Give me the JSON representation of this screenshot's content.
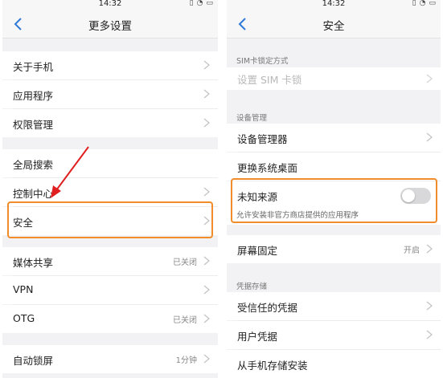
{
  "status_bar": {
    "time_left": "14:32",
    "time_right": "14:32",
    "icons": [
      "sim-icon",
      "wifi-icon",
      "battery-icon"
    ]
  },
  "left_screen": {
    "title": "更多设置",
    "items": [
      {
        "label": "关于手机"
      },
      {
        "label": "应用程序"
      },
      {
        "label": "权限管理"
      },
      {
        "label": "全局搜索"
      },
      {
        "label": "控制中心"
      },
      {
        "label": "安全"
      },
      {
        "label": "媒体共享",
        "value": "已关闭"
      },
      {
        "label": "VPN"
      },
      {
        "label": "OTG",
        "value": "已关闭"
      },
      {
        "label": "自动锁屏",
        "value": "1分钟"
      }
    ]
  },
  "right_screen": {
    "title": "安全",
    "sim_section_header": "SIM卡锁定方式",
    "sim_lock_item": "设置 SIM 卡锁",
    "device_section_header": "设备管理",
    "device_manager": "设备管理器",
    "change_launcher": "更换系统桌面",
    "unknown_sources": "未知来源",
    "unknown_sources_desc": "允许安装非官方商店提供的应用程序",
    "unknown_sources_enabled": false,
    "screen_pinning": "屏幕固定",
    "screen_pinning_value": "开启",
    "credential_section_header": "凭据存储",
    "trusted_credentials": "受信任的凭据",
    "user_credentials": "用户凭据",
    "install_from_storage": "从手机存储安装"
  },
  "colors": {
    "highlight": "#f08c2a",
    "arrow": "#e02020",
    "accent_back": "#2f7ad8",
    "background": "#f2f2f4"
  }
}
